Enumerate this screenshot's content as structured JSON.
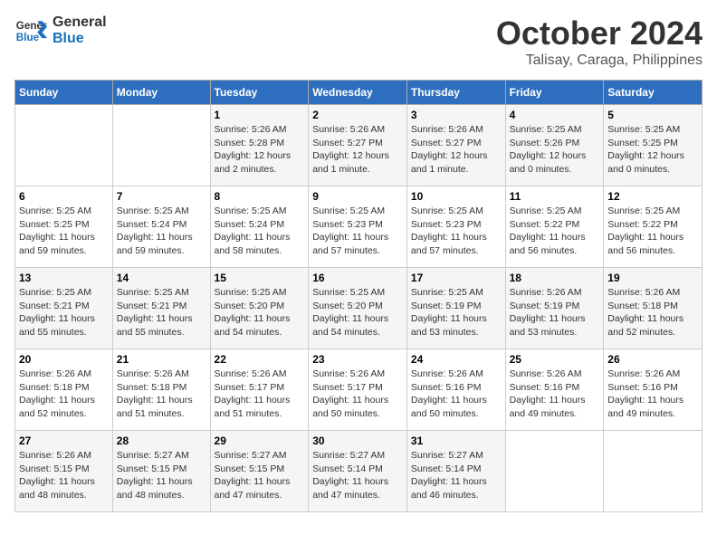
{
  "logo": {
    "line1": "General",
    "line2": "Blue"
  },
  "title": "October 2024",
  "subtitle": "Talisay, Caraga, Philippines",
  "weekdays": [
    "Sunday",
    "Monday",
    "Tuesday",
    "Wednesday",
    "Thursday",
    "Friday",
    "Saturday"
  ],
  "weeks": [
    [
      {
        "day": "",
        "info": ""
      },
      {
        "day": "",
        "info": ""
      },
      {
        "day": "1",
        "info": "Sunrise: 5:26 AM\nSunset: 5:28 PM\nDaylight: 12 hours\nand 2 minutes."
      },
      {
        "day": "2",
        "info": "Sunrise: 5:26 AM\nSunset: 5:27 PM\nDaylight: 12 hours\nand 1 minute."
      },
      {
        "day": "3",
        "info": "Sunrise: 5:26 AM\nSunset: 5:27 PM\nDaylight: 12 hours\nand 1 minute."
      },
      {
        "day": "4",
        "info": "Sunrise: 5:25 AM\nSunset: 5:26 PM\nDaylight: 12 hours\nand 0 minutes."
      },
      {
        "day": "5",
        "info": "Sunrise: 5:25 AM\nSunset: 5:25 PM\nDaylight: 12 hours\nand 0 minutes."
      }
    ],
    [
      {
        "day": "6",
        "info": "Sunrise: 5:25 AM\nSunset: 5:25 PM\nDaylight: 11 hours\nand 59 minutes."
      },
      {
        "day": "7",
        "info": "Sunrise: 5:25 AM\nSunset: 5:24 PM\nDaylight: 11 hours\nand 59 minutes."
      },
      {
        "day": "8",
        "info": "Sunrise: 5:25 AM\nSunset: 5:24 PM\nDaylight: 11 hours\nand 58 minutes."
      },
      {
        "day": "9",
        "info": "Sunrise: 5:25 AM\nSunset: 5:23 PM\nDaylight: 11 hours\nand 57 minutes."
      },
      {
        "day": "10",
        "info": "Sunrise: 5:25 AM\nSunset: 5:23 PM\nDaylight: 11 hours\nand 57 minutes."
      },
      {
        "day": "11",
        "info": "Sunrise: 5:25 AM\nSunset: 5:22 PM\nDaylight: 11 hours\nand 56 minutes."
      },
      {
        "day": "12",
        "info": "Sunrise: 5:25 AM\nSunset: 5:22 PM\nDaylight: 11 hours\nand 56 minutes."
      }
    ],
    [
      {
        "day": "13",
        "info": "Sunrise: 5:25 AM\nSunset: 5:21 PM\nDaylight: 11 hours\nand 55 minutes."
      },
      {
        "day": "14",
        "info": "Sunrise: 5:25 AM\nSunset: 5:21 PM\nDaylight: 11 hours\nand 55 minutes."
      },
      {
        "day": "15",
        "info": "Sunrise: 5:25 AM\nSunset: 5:20 PM\nDaylight: 11 hours\nand 54 minutes."
      },
      {
        "day": "16",
        "info": "Sunrise: 5:25 AM\nSunset: 5:20 PM\nDaylight: 11 hours\nand 54 minutes."
      },
      {
        "day": "17",
        "info": "Sunrise: 5:25 AM\nSunset: 5:19 PM\nDaylight: 11 hours\nand 53 minutes."
      },
      {
        "day": "18",
        "info": "Sunrise: 5:26 AM\nSunset: 5:19 PM\nDaylight: 11 hours\nand 53 minutes."
      },
      {
        "day": "19",
        "info": "Sunrise: 5:26 AM\nSunset: 5:18 PM\nDaylight: 11 hours\nand 52 minutes."
      }
    ],
    [
      {
        "day": "20",
        "info": "Sunrise: 5:26 AM\nSunset: 5:18 PM\nDaylight: 11 hours\nand 52 minutes."
      },
      {
        "day": "21",
        "info": "Sunrise: 5:26 AM\nSunset: 5:18 PM\nDaylight: 11 hours\nand 51 minutes."
      },
      {
        "day": "22",
        "info": "Sunrise: 5:26 AM\nSunset: 5:17 PM\nDaylight: 11 hours\nand 51 minutes."
      },
      {
        "day": "23",
        "info": "Sunrise: 5:26 AM\nSunset: 5:17 PM\nDaylight: 11 hours\nand 50 minutes."
      },
      {
        "day": "24",
        "info": "Sunrise: 5:26 AM\nSunset: 5:16 PM\nDaylight: 11 hours\nand 50 minutes."
      },
      {
        "day": "25",
        "info": "Sunrise: 5:26 AM\nSunset: 5:16 PM\nDaylight: 11 hours\nand 49 minutes."
      },
      {
        "day": "26",
        "info": "Sunrise: 5:26 AM\nSunset: 5:16 PM\nDaylight: 11 hours\nand 49 minutes."
      }
    ],
    [
      {
        "day": "27",
        "info": "Sunrise: 5:26 AM\nSunset: 5:15 PM\nDaylight: 11 hours\nand 48 minutes."
      },
      {
        "day": "28",
        "info": "Sunrise: 5:27 AM\nSunset: 5:15 PM\nDaylight: 11 hours\nand 48 minutes."
      },
      {
        "day": "29",
        "info": "Sunrise: 5:27 AM\nSunset: 5:15 PM\nDaylight: 11 hours\nand 47 minutes."
      },
      {
        "day": "30",
        "info": "Sunrise: 5:27 AM\nSunset: 5:14 PM\nDaylight: 11 hours\nand 47 minutes."
      },
      {
        "day": "31",
        "info": "Sunrise: 5:27 AM\nSunset: 5:14 PM\nDaylight: 11 hours\nand 46 minutes."
      },
      {
        "day": "",
        "info": ""
      },
      {
        "day": "",
        "info": ""
      }
    ]
  ]
}
